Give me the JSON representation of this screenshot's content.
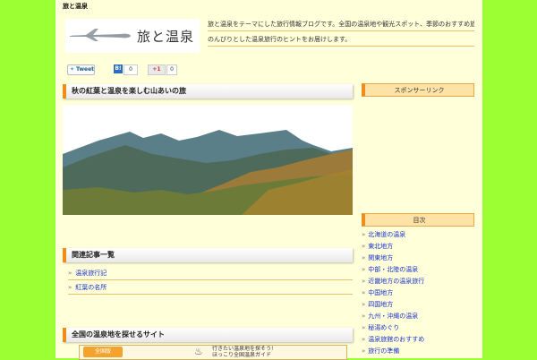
{
  "site": {
    "label": "旅と温泉"
  },
  "logo": {
    "text": "旅と温泉"
  },
  "description": {
    "line1": "旅と温泉をテーマにした旅行情報ブログです。全国の温泉地や観光スポット、季節のおすすめ旅行プランなどをご紹介しています。",
    "line2": "のんびりとした温泉旅行のヒントをお届けします。"
  },
  "social": {
    "tweet": "Tweet",
    "hatena": "B!",
    "hatena_count": "0",
    "gplus": "+1",
    "gplus_count": "0"
  },
  "main": {
    "article_title": "秋の紅葉と温泉を楽しむ山あいの旅",
    "related_title": "関連記事一覧",
    "related_items": [
      "温泉旅行記",
      "紅葉の名所"
    ],
    "ad_title": "全国の温泉地を探せるサイト"
  },
  "banner": {
    "badge": "全国版",
    "text_line1": "行きたい温泉地を探そう!",
    "text_line2": "ほっこり全国温泉ガイド"
  },
  "sidebar": {
    "ad_heading": "スポンサーリンク",
    "category_heading": "目次",
    "categories": [
      "北海道の温泉",
      "東北地方",
      "関東地方",
      "中部・北陸の温泉",
      "近畿地方の温泉旅行",
      "中国地方",
      "四国地方",
      "九州・沖縄の温泉",
      "秘湯めぐり",
      "温泉旅館のおすすめ",
      "旅行の準備"
    ]
  }
}
